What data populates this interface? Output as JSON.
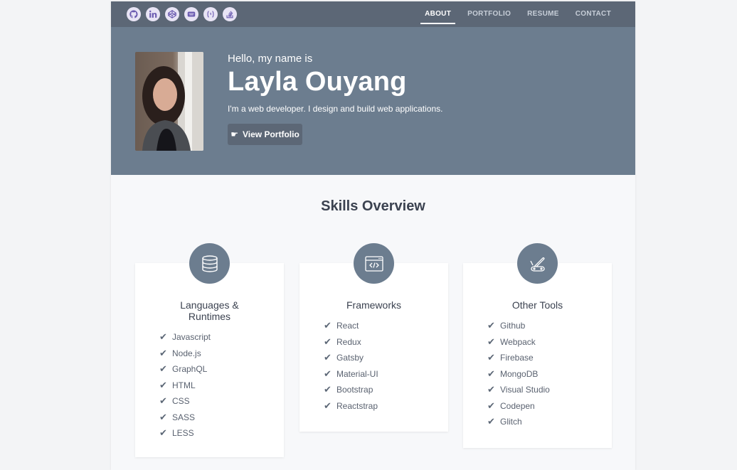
{
  "nav": {
    "social_icons": [
      "github-icon",
      "linkedin-icon",
      "codepen-icon",
      "codewars-icon",
      "freecodecamp-icon",
      "stackoverflow-icon"
    ],
    "menu": [
      {
        "label": "ABOUT",
        "active": true
      },
      {
        "label": "PORTFOLIO",
        "active": false
      },
      {
        "label": "RESUME",
        "active": false
      },
      {
        "label": "CONTACT",
        "active": false
      }
    ]
  },
  "hero": {
    "greeting": "Hello, my name is",
    "name": "Layla Ouyang",
    "tagline": "I'm a web developer. I design and build web applications.",
    "cta_label": "View Portfolio",
    "cta_icon": "hand-pointing-right-icon"
  },
  "skills": {
    "title": "Skills Overview",
    "cards": [
      {
        "title": "Languages & Runtimes",
        "icon": "database-icon",
        "items": [
          "Javascript",
          "Node.js",
          "GraphQL",
          "HTML",
          "CSS",
          "SASS",
          "LESS"
        ]
      },
      {
        "title": "Frameworks",
        "icon": "browser-code-icon",
        "items": [
          "React",
          "Redux",
          "Gatsby",
          "Material-UI",
          "Bootstrap",
          "Reactstrap"
        ]
      },
      {
        "title": "Other Tools",
        "icon": "swiss-knife-icon",
        "items": [
          "Github",
          "Webpack",
          "Firebase",
          "MongoDB",
          "Visual Studio",
          "Codepen",
          "Glitch"
        ]
      }
    ]
  },
  "colors": {
    "nav_bg": "#5c6776",
    "hero_bg": "#6c7d8f",
    "badge_bg": "#6c7d8f",
    "page_bg": "#f7f8fa"
  }
}
